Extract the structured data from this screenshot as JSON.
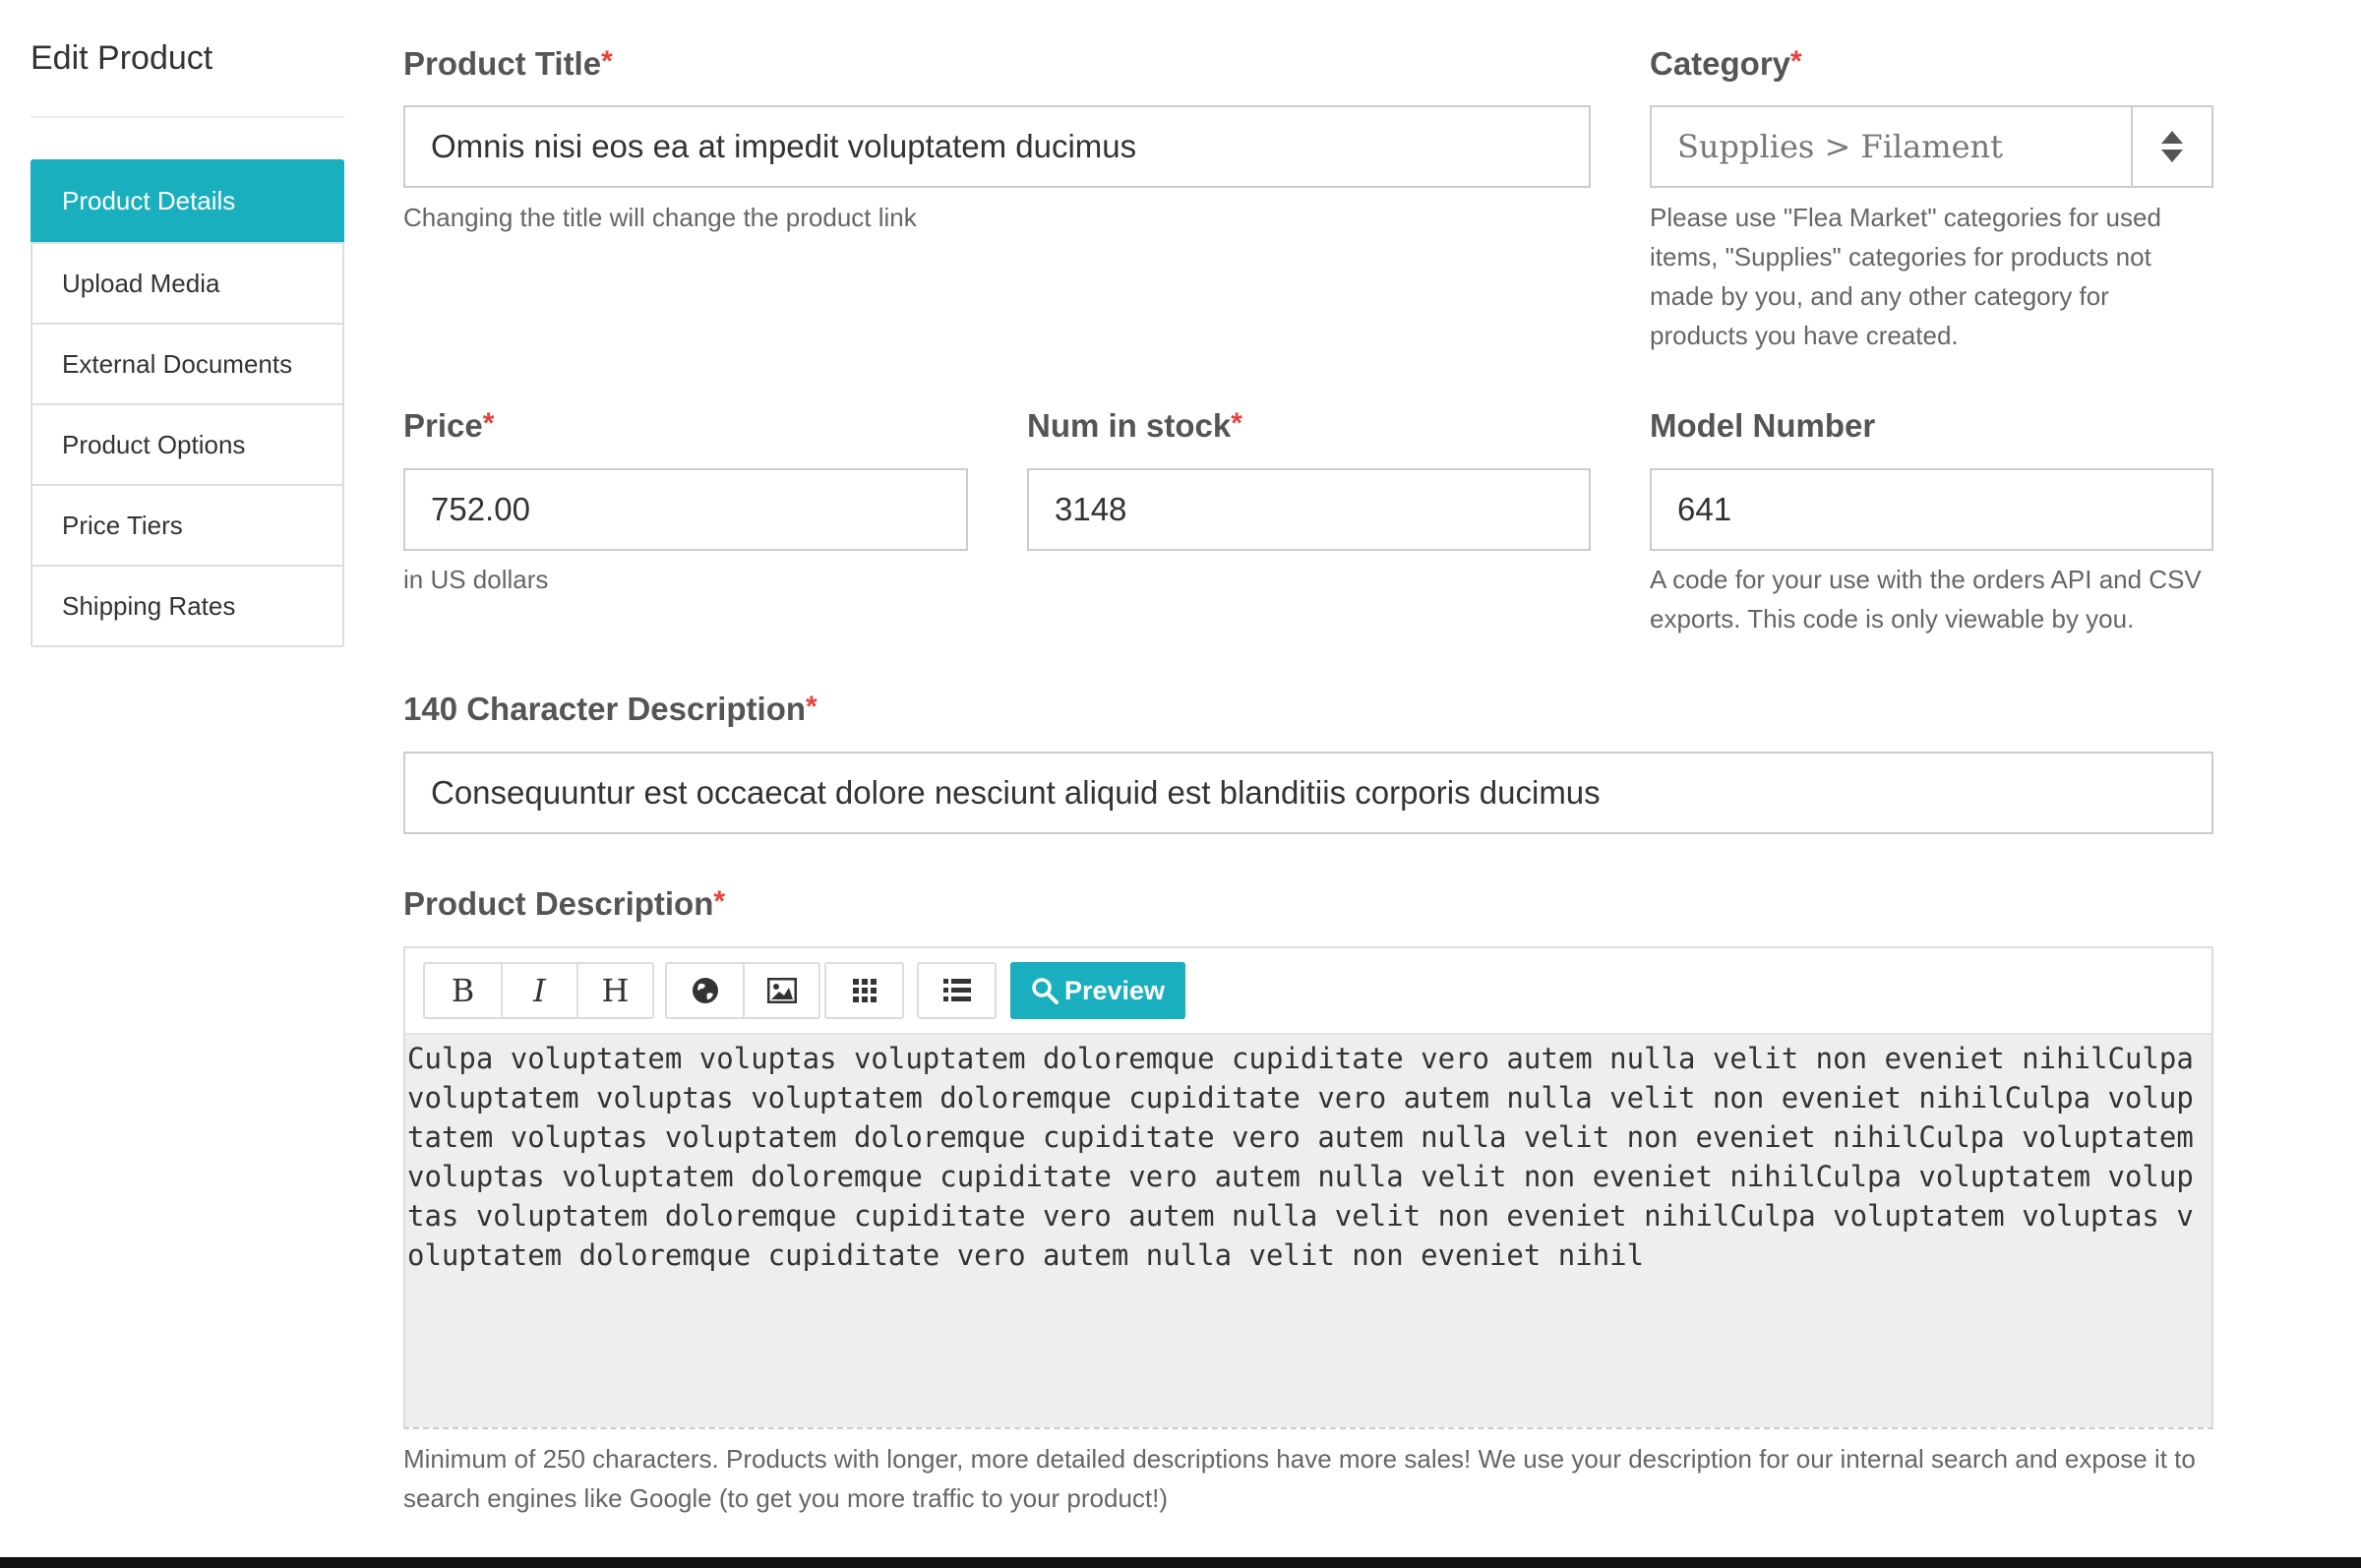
{
  "sidebar": {
    "title": "Edit Product",
    "items": [
      {
        "label": "Product Details",
        "active": true
      },
      {
        "label": "Upload Media"
      },
      {
        "label": "External Documents"
      },
      {
        "label": "Product Options"
      },
      {
        "label": "Price Tiers"
      },
      {
        "label": "Shipping Rates"
      }
    ]
  },
  "required_mark": "*",
  "title_field": {
    "label": "Product Title",
    "value": "Omnis nisi eos ea at impedit voluptatem ducimus",
    "help": "Changing the title will change the product link"
  },
  "category_field": {
    "label": "Category",
    "value": "Supplies > Filament",
    "help": "Please use \"Flea Market\" categories for used items, \"Supplies\" categories for products not made by you, and any other category for products you have created."
  },
  "price_field": {
    "label": "Price",
    "value": "752.00",
    "help": "in US dollars"
  },
  "stock_field": {
    "label": "Num in stock",
    "value": "3148"
  },
  "model_field": {
    "label": "Model Number",
    "value": "641",
    "help": "A code for your use with the orders API and CSV exports. This code is only viewable by you."
  },
  "short_desc_field": {
    "label": "140 Character Description",
    "value": "Consequuntur est occaecat dolore nesciunt aliquid est blanditiis corporis ducimus"
  },
  "description_field": {
    "label": "Product Description",
    "toolbar": {
      "bold": "B",
      "italic": "I",
      "heading": "H",
      "preview": "Preview"
    },
    "value": "Culpa voluptatem voluptas voluptatem doloremque cupiditate vero autem nulla velit non eveniet nihilCulpa voluptatem voluptas voluptatem doloremque cupiditate vero autem nulla velit non eveniet nihilCulpa voluptatem voluptas voluptatem doloremque cupiditate vero autem nulla velit non eveniet nihilCulpa voluptatem voluptas voluptatem doloremque cupiditate vero autem nulla velit non eveniet nihilCulpa voluptatem voluptas voluptatem doloremque cupiditate vero autem nulla velit non eveniet nihilCulpa voluptatem voluptas voluptatem doloremque cupiditate vero autem nulla velit non eveniet nihil",
    "help": "Minimum of 250 characters. Products with longer, more detailed descriptions have more sales! We use your description for our internal search and expose it to search engines like Google (to get you more traffic to your product!)"
  },
  "colors": {
    "accent": "#1aafbe",
    "required": "#e8413c",
    "editor_bg": "#eeeeee"
  }
}
